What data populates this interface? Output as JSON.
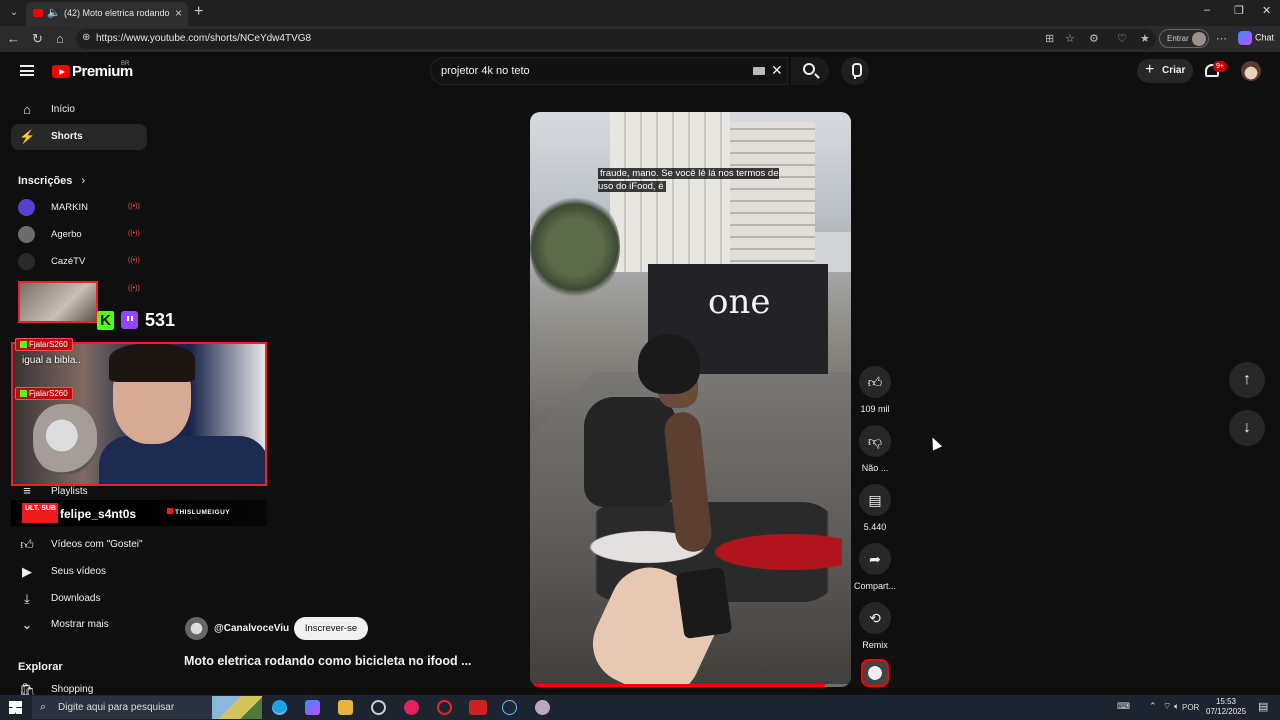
{
  "browser": {
    "tab_title": "(42) Moto eletrica rodando como bicicleta no ifood",
    "url": "https://www.youtube.com/shorts/NCeYdw4TVG8",
    "entrar_label": "Entrar",
    "chat_label": "Chat"
  },
  "header": {
    "logo_text": "Premium",
    "logo_region": "BR",
    "search_value": "projetor 4k no teto",
    "criar_label": "Criar",
    "notification_count": "9+"
  },
  "sidebar": {
    "items": [
      {
        "label": "Início",
        "icon": "home-icon"
      },
      {
        "label": "Shorts",
        "icon": "shorts-icon"
      }
    ],
    "inscricoes_title": "Inscrições",
    "subscriptions": [
      {
        "label": "MARKIN",
        "color": "#5b3fd1"
      },
      {
        "label": "Agerbo",
        "color": "#6c6c6c"
      },
      {
        "label": "CazéTV",
        "color": "#2a2a2a"
      }
    ],
    "playlists_label": "Playlists",
    "you_items": [
      {
        "label": "Vídeos com \"Gostei\"",
        "icon": "like-icon"
      },
      {
        "label": "Seus vídeos",
        "icon": "your-videos-icon"
      },
      {
        "label": "Downloads",
        "icon": "download-icon"
      },
      {
        "label": "Mostrar mais",
        "icon": "chevron-down-icon"
      }
    ],
    "explorar_title": "Explorar",
    "shopping_label": "Shopping"
  },
  "overlay": {
    "viewer_count": "531",
    "chat_user_1": "FjalarS260",
    "chat_message": "igual a bibla..",
    "chat_user_2": "FjalarS260",
    "streamer_name": "felipe_s4nt0s",
    "badge_text": "ULT. SUB",
    "brand_text": "THISLUMEIGUY"
  },
  "video": {
    "caption": "fraude, mano. Se você lê lá nos termos de uso do iFood, é",
    "storefront_text": "one",
    "progress": 0.92,
    "channel": "@CanalvoceViu",
    "subscribe_label": "Inscrever-se",
    "title": "Moto eletrica rodando como bicicleta no ifood ..."
  },
  "actions": {
    "likes": "109 mil",
    "dislike_label": "Não ...",
    "comments": "5.440",
    "share_label": "Compart...",
    "remix_label": "Remix"
  },
  "taskbar": {
    "search_placeholder": "Digite aqui para pesquisar",
    "language": "POR",
    "time": "15:53",
    "date": "07/12/2025"
  }
}
